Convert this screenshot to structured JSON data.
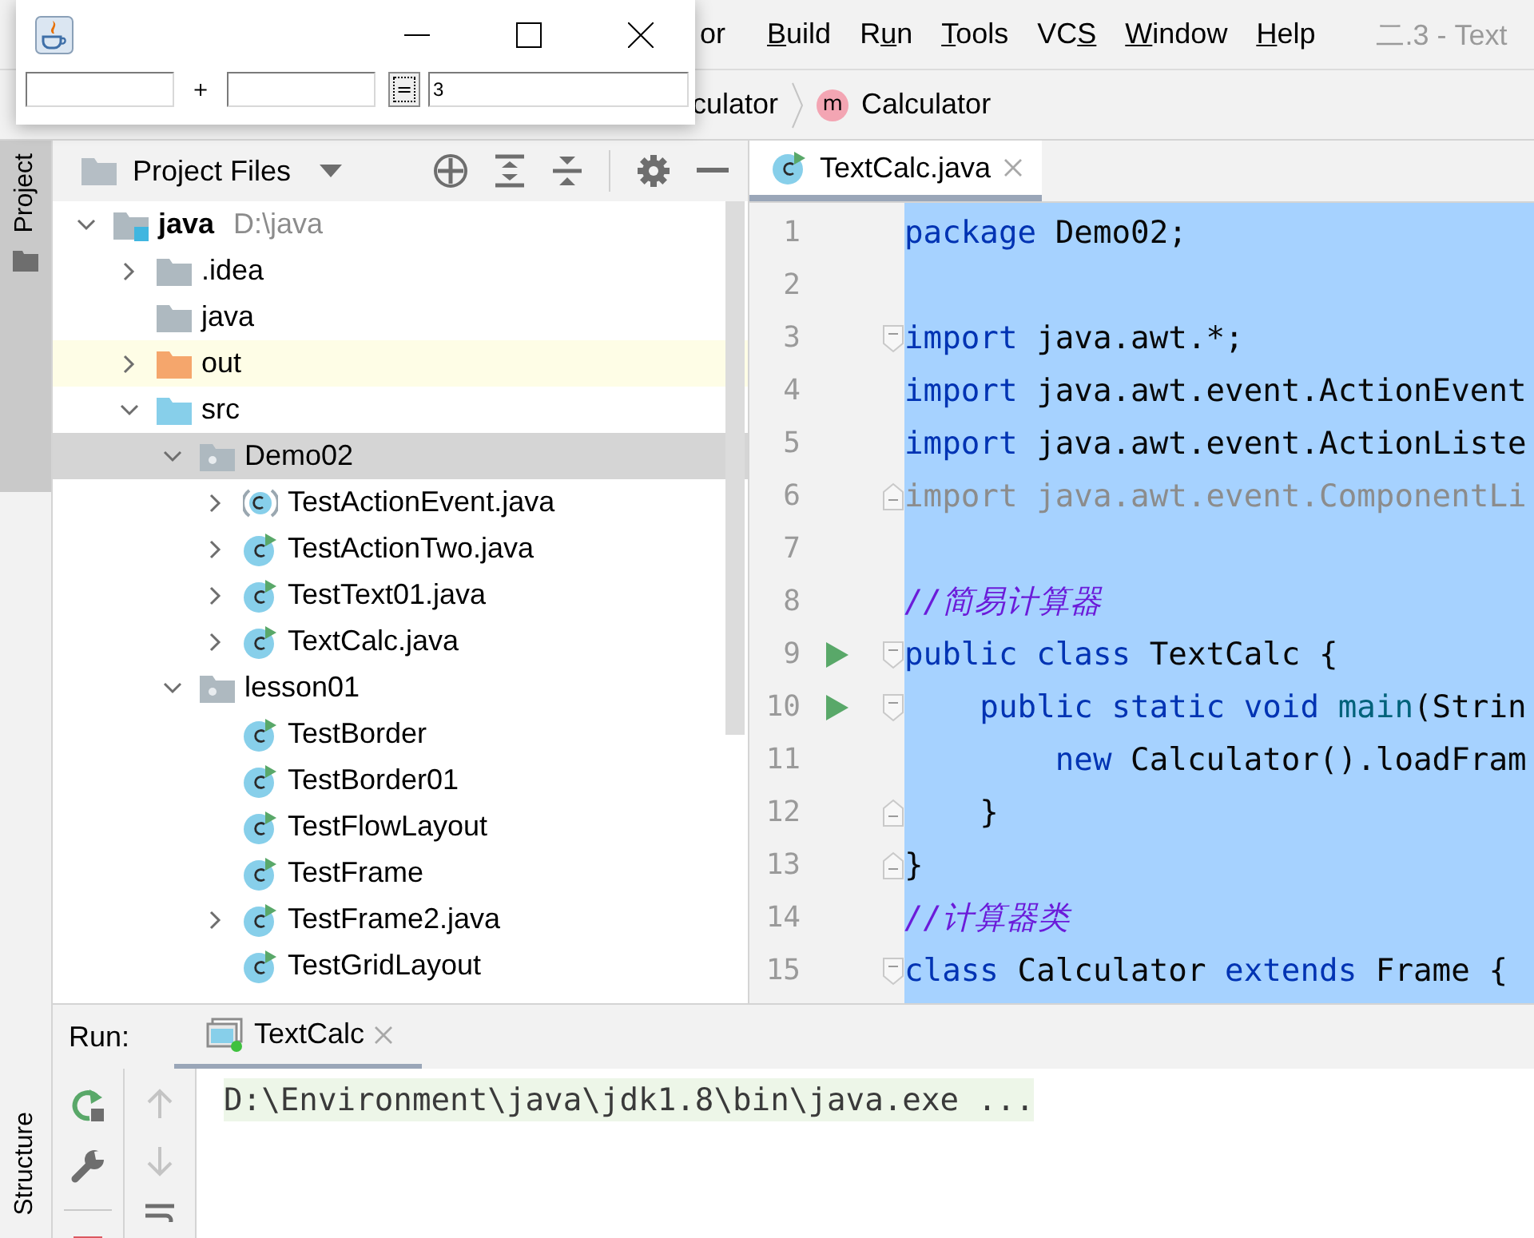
{
  "calc_window": {
    "operator": "+",
    "equals_button": "=",
    "result_value": "3"
  },
  "menu": [
    {
      "parts": [
        {
          "text": "or",
          "underlined": false
        }
      ]
    },
    {
      "parts": [
        {
          "text": "B",
          "underlined": true
        },
        {
          "text": "uild",
          "underlined": false
        }
      ]
    },
    {
      "parts": [
        {
          "text": "R",
          "underlined": false
        },
        {
          "text": "u",
          "underlined": true
        },
        {
          "text": "n",
          "underlined": false
        }
      ]
    },
    {
      "parts": [
        {
          "text": "T",
          "underlined": true
        },
        {
          "text": "ools",
          "underlined": false
        }
      ]
    },
    {
      "parts": [
        {
          "text": "VC",
          "underlined": false
        },
        {
          "text": "S",
          "underlined": true
        }
      ]
    },
    {
      "parts": [
        {
          "text": "W",
          "underlined": true
        },
        {
          "text": "indow",
          "underlined": false
        }
      ]
    },
    {
      "parts": [
        {
          "text": "H",
          "underlined": true
        },
        {
          "text": "elp",
          "underlined": false
        }
      ]
    }
  ],
  "window_title": "二.3 - Text",
  "breadcrumb": [
    {
      "label": "culator"
    },
    {
      "label": "Calculator",
      "badge": "m"
    }
  ],
  "side_tabs": [
    {
      "label": "Project",
      "selected": true
    }
  ],
  "bottom_side_tabs": [
    {
      "label": "Structure",
      "selected": false
    }
  ],
  "project_panel": {
    "title": "Project Files",
    "tree": [
      {
        "name": "java",
        "path": "D:\\java",
        "kind": "module",
        "expanded": true,
        "selected": false,
        "children": [
          {
            "name": ".idea",
            "kind": "folder",
            "expanded": false,
            "selected": false
          },
          {
            "name": "java",
            "kind": "folder",
            "selected": false
          },
          {
            "name": "out",
            "kind": "excluded",
            "expanded": false,
            "selected": false
          },
          {
            "name": "src",
            "kind": "source",
            "expanded": true,
            "selected": false,
            "children": [
              {
                "name": "Demo02",
                "kind": "package",
                "expanded": true,
                "selected": true,
                "children": [
                  {
                    "name": "TestActionEvent.java",
                    "kind": "class",
                    "expanded": false,
                    "selected": false
                  },
                  {
                    "name": "TestActionTwo.java",
                    "kind": "runnable",
                    "expanded": false,
                    "selected": false
                  },
                  {
                    "name": "TestText01.java",
                    "kind": "runnable",
                    "expanded": false,
                    "selected": false
                  },
                  {
                    "name": "TextCalc.java",
                    "kind": "runnable",
                    "expanded": false,
                    "selected": false
                  }
                ]
              },
              {
                "name": "lesson01",
                "kind": "package",
                "expanded": true,
                "selected": false,
                "children": [
                  {
                    "name": "TestBorder",
                    "kind": "runnable",
                    "selected": false
                  },
                  {
                    "name": "TestBorder01",
                    "kind": "runnable",
                    "selected": false
                  },
                  {
                    "name": "TestFlowLayout",
                    "kind": "runnable",
                    "selected": false
                  },
                  {
                    "name": "TestFrame",
                    "kind": "runnable",
                    "selected": false
                  },
                  {
                    "name": "TestFrame2.java",
                    "kind": "runnable",
                    "expanded": false,
                    "selected": false
                  },
                  {
                    "name": "TestGridLayout",
                    "kind": "runnable",
                    "selected": false
                  }
                ]
              }
            ]
          }
        ]
      }
    ]
  },
  "editor": {
    "tabs": [
      {
        "label": "TextCalc.java",
        "selected": true
      }
    ],
    "lines": [
      {
        "number": "1",
        "tokens": [
          {
            "t": "package",
            "kind": "keyword"
          },
          {
            "t": " Demo02;",
            "kind": "plain"
          }
        ]
      },
      {
        "number": "2"
      },
      {
        "number": "3",
        "fold_marker": {
          "kind": "start"
        },
        "tokens": [
          {
            "t": "import",
            "kind": "keyword"
          },
          {
            "t": " java.awt.*;",
            "kind": "plain"
          }
        ]
      },
      {
        "number": "4",
        "tokens": [
          {
            "t": "import",
            "kind": "keyword"
          },
          {
            "t": " java.awt.event.ActionEvent",
            "kind": "plain"
          }
        ]
      },
      {
        "number": "5",
        "tokens": [
          {
            "t": "import",
            "kind": "keyword"
          },
          {
            "t": " java.awt.event.ActionListe",
            "kind": "plain"
          }
        ]
      },
      {
        "number": "6",
        "fold_marker": {
          "kind": "end"
        },
        "tokens": [
          {
            "t": "import java.awt.event.ComponentLi",
            "kind": "unused"
          }
        ]
      },
      {
        "number": "7"
      },
      {
        "number": "8",
        "tokens": [
          {
            "t": "//简易计算器",
            "kind": "comment"
          }
        ]
      },
      {
        "number": "9",
        "run": true,
        "fold_marker": {
          "kind": "start"
        },
        "tokens": [
          {
            "t": "public class",
            "kind": "keyword"
          },
          {
            "t": " TextCalc {",
            "kind": "plain"
          }
        ]
      },
      {
        "number": "10",
        "run": true,
        "fold_marker": {
          "kind": "start"
        },
        "tokens": [
          {
            "t": "    public static void",
            "kind": "keyword"
          },
          {
            "t": " main",
            "kind": "method"
          },
          {
            "t": "(Strin",
            "kind": "plain"
          }
        ]
      },
      {
        "number": "11",
        "tokens": [
          {
            "t": "        new",
            "kind": "keyword"
          },
          {
            "t": " Calculator().loadFram",
            "kind": "plain"
          }
        ]
      },
      {
        "number": "12",
        "fold_marker": {
          "kind": "end"
        },
        "tokens": [
          {
            "t": "    }",
            "kind": "plain"
          }
        ]
      },
      {
        "number": "13",
        "fold_marker": {
          "kind": "end"
        },
        "tokens": [
          {
            "t": "}",
            "kind": "plain"
          }
        ]
      },
      {
        "number": "14",
        "tokens": [
          {
            "t": "//计算器类",
            "kind": "comment"
          }
        ]
      },
      {
        "number": "15",
        "fold_marker": {
          "kind": "start"
        },
        "tokens": [
          {
            "t": "class",
            "kind": "keyword"
          },
          {
            "t": " Calculator ",
            "kind": "plain"
          },
          {
            "t": "extends",
            "kind": "keyword"
          },
          {
            "t": " Frame {",
            "kind": "plain"
          }
        ]
      }
    ]
  },
  "run_panel": {
    "label": "Run:",
    "tabs": [
      {
        "label": "TextCalc",
        "selected": true
      }
    ],
    "console": [
      "D:\\Environment\\java\\jdk1.8\\bin\\java.exe ..."
    ]
  }
}
